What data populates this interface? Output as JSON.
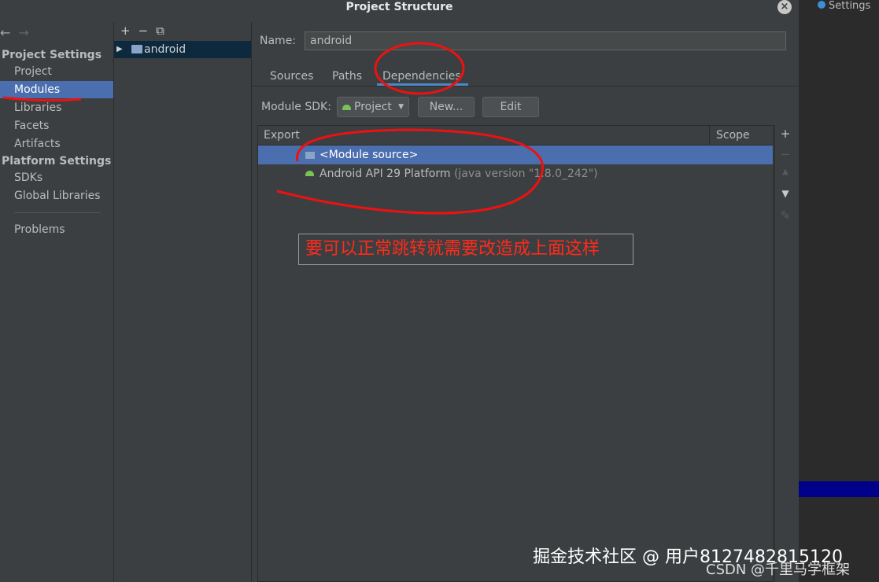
{
  "window": {
    "title": "Project Structure",
    "close_icon": "close-icon"
  },
  "sidebar": {
    "back": "←",
    "forward": "→",
    "project_settings_header": "Project Settings",
    "items": [
      "Project",
      "Modules",
      "Libraries",
      "Facets",
      "Artifacts"
    ],
    "platform_settings_header": "Platform Settings",
    "platform_items": [
      "SDKs",
      "Global Libraries"
    ],
    "problems": "Problems",
    "selected": "Modules"
  },
  "tree": {
    "toolbar": [
      "+",
      "−",
      "⧉"
    ],
    "node": "android"
  },
  "main": {
    "name_label": "Name:",
    "name_value": "android",
    "tabs": [
      "Sources",
      "Paths",
      "Dependencies"
    ],
    "active_tab": "Dependencies",
    "module_sdk_label": "Module SDK:",
    "module_sdk_value": "Project",
    "new_button": "New...",
    "edit_button": "Edit",
    "table": {
      "headers": [
        "Export",
        "Scope"
      ],
      "rows": [
        {
          "label": "<Module source>",
          "extra": "",
          "selected": true
        },
        {
          "label": "Android API 29 Platform",
          "extra": "(java version \"1.8.0_242\")",
          "selected": false
        }
      ]
    },
    "side_toolbar": [
      "+",
      "−",
      "▲",
      "▼",
      "✎"
    ]
  },
  "annotation": {
    "text": "要可以正常跳转就需要改造成上面这样",
    "color": "#ff2a1a"
  },
  "background_window": {
    "tab": "Settings"
  },
  "watermark": {
    "line1": "掘金技术社区 @ 用户8127482815120",
    "line2": "CSDN @千里马学框架"
  },
  "colors": {
    "selection": "#4b6eaf",
    "tab_underline": "#4a88c7",
    "dialog_bg": "#3c3f41"
  }
}
